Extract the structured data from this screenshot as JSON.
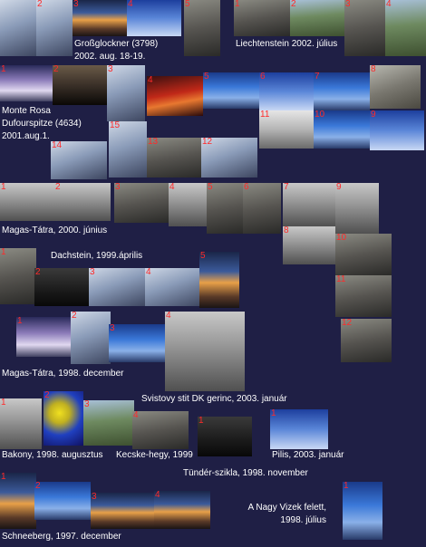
{
  "captions": {
    "grossglockner": "Großglockner (3798)\n2002. aug. 18-19.",
    "liechtenstein": "Liechtenstein  2002. július",
    "monte_rosa": "Monte Rosa\nDufourspitze (4634)\n2001.aug.1.",
    "magas_tatra_2000": "Magas-Tátra, 2000. június",
    "dachstein": "Dachstein, 1999.április",
    "magas_tatra_1998": "Magas-Tátra, 1998. december",
    "svistovy": "Svistovy stit DK gerinc, 2003. január",
    "bakony": "Bakony, 1998. augusztus",
    "kecske": "Kecske-hegy, 1999",
    "pilis": "Pilis, 2003. január",
    "tunder": "Tündér-szikla, 1998. november",
    "nagy_vizek": "A Nagy Vizek felett,\n1998. július",
    "schneeberg": "Schneeberg, 1997. december"
  },
  "thumbs": [
    {
      "n": "",
      "c": "snow"
    },
    {
      "n": "2",
      "c": "snow"
    },
    {
      "n": "3",
      "c": "sunset"
    },
    {
      "n": "4",
      "c": "sky"
    },
    {
      "n": "5",
      "c": "rock"
    },
    {
      "n": "1",
      "c": "rock"
    },
    {
      "n": "2",
      "c": "green"
    },
    {
      "n": "3",
      "c": "rock"
    },
    {
      "n": "4",
      "c": "green"
    },
    {
      "n": "1",
      "c": "purple"
    },
    {
      "n": "2",
      "c": "cave"
    },
    {
      "n": "3",
      "c": "snow"
    },
    {
      "n": "4",
      "c": "red"
    },
    {
      "n": "5",
      "c": "blue"
    },
    {
      "n": "6",
      "c": "sky"
    },
    {
      "n": "7",
      "c": "blue"
    },
    {
      "n": "8",
      "c": "plaque"
    },
    {
      "n": "14",
      "c": "snow"
    },
    {
      "n": "15",
      "c": "snow"
    },
    {
      "n": "11",
      "c": "cloud"
    },
    {
      "n": "10",
      "c": "blue"
    },
    {
      "n": "9",
      "c": "sky"
    },
    {
      "n": "13",
      "c": "rock"
    },
    {
      "n": "12",
      "c": "snow"
    },
    {
      "n": "1",
      "c": "mist"
    },
    {
      "n": "2",
      "c": "mist"
    },
    {
      "n": "3",
      "c": "rock"
    },
    {
      "n": "4",
      "c": "mist"
    },
    {
      "n": "5",
      "c": "rock"
    },
    {
      "n": "6",
      "c": "rock"
    },
    {
      "n": "7",
      "c": "mist"
    },
    {
      "n": "9",
      "c": "mist"
    },
    {
      "n": "8",
      "c": "mist"
    },
    {
      "n": "10",
      "c": "rock"
    },
    {
      "n": "11",
      "c": "rock"
    },
    {
      "n": "12",
      "c": "rock"
    },
    {
      "n": "1",
      "c": "rock"
    },
    {
      "n": "2",
      "c": "dark"
    },
    {
      "n": "3",
      "c": "snow"
    },
    {
      "n": "4",
      "c": "snow"
    },
    {
      "n": "5",
      "c": "sunset"
    },
    {
      "n": "1",
      "c": "purple"
    },
    {
      "n": "2",
      "c": "snow"
    },
    {
      "n": "3",
      "c": "blue"
    },
    {
      "n": "4",
      "c": "mist"
    },
    {
      "n": "1",
      "c": "mist"
    },
    {
      "n": "2",
      "c": "yellow"
    },
    {
      "n": "3",
      "c": "green"
    },
    {
      "n": "4",
      "c": "rock"
    },
    {
      "n": "1",
      "c": "dark"
    },
    {
      "n": "1",
      "c": "sky"
    },
    {
      "n": "1",
      "c": "sunset"
    },
    {
      "n": "2",
      "c": "blue"
    },
    {
      "n": "3",
      "c": "sunset"
    },
    {
      "n": "4",
      "c": "sunset"
    },
    {
      "n": "1",
      "c": "blue"
    }
  ]
}
